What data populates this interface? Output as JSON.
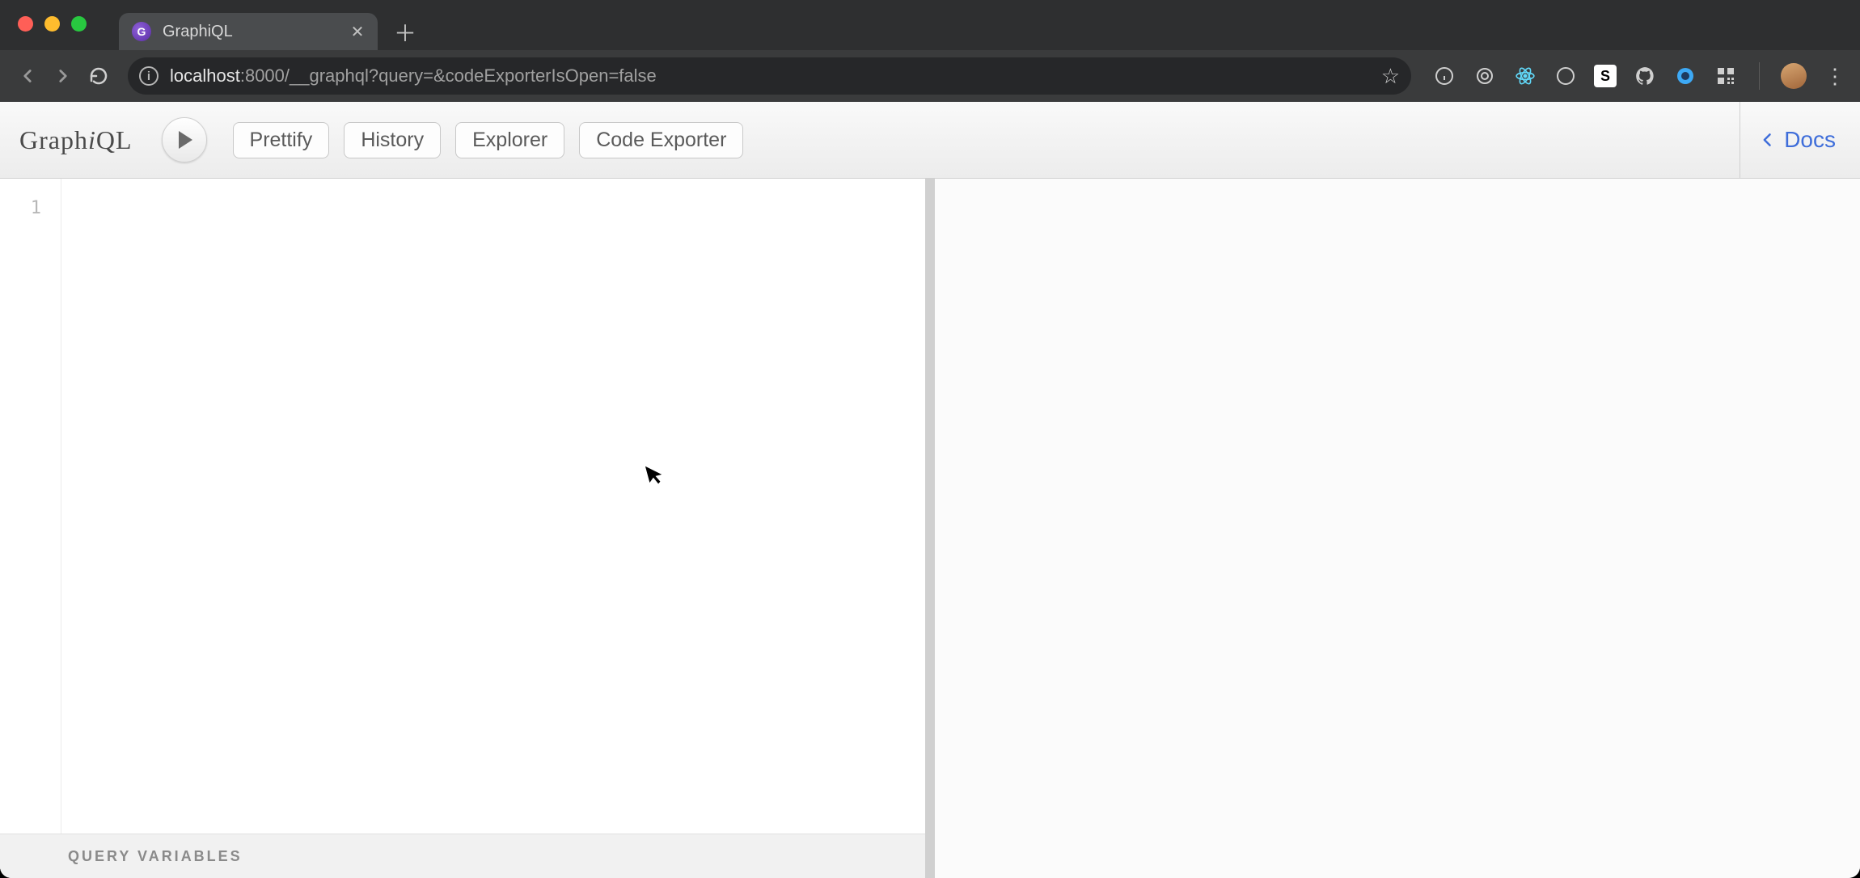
{
  "browser": {
    "tab_title": "GraphiQL",
    "url_host": "localhost",
    "url_path": ":8000/__graphql?query=&codeExporterIsOpen=false"
  },
  "app": {
    "logo_part1": "Graph",
    "logo_em": "i",
    "logo_part2": "QL",
    "buttons": {
      "prettify": "Prettify",
      "history": "History",
      "explorer": "Explorer",
      "code_exporter": "Code Exporter"
    },
    "docs_label": "Docs"
  },
  "editor": {
    "line_number_1": "1",
    "query_variables_label": "QUERY VARIABLES"
  }
}
